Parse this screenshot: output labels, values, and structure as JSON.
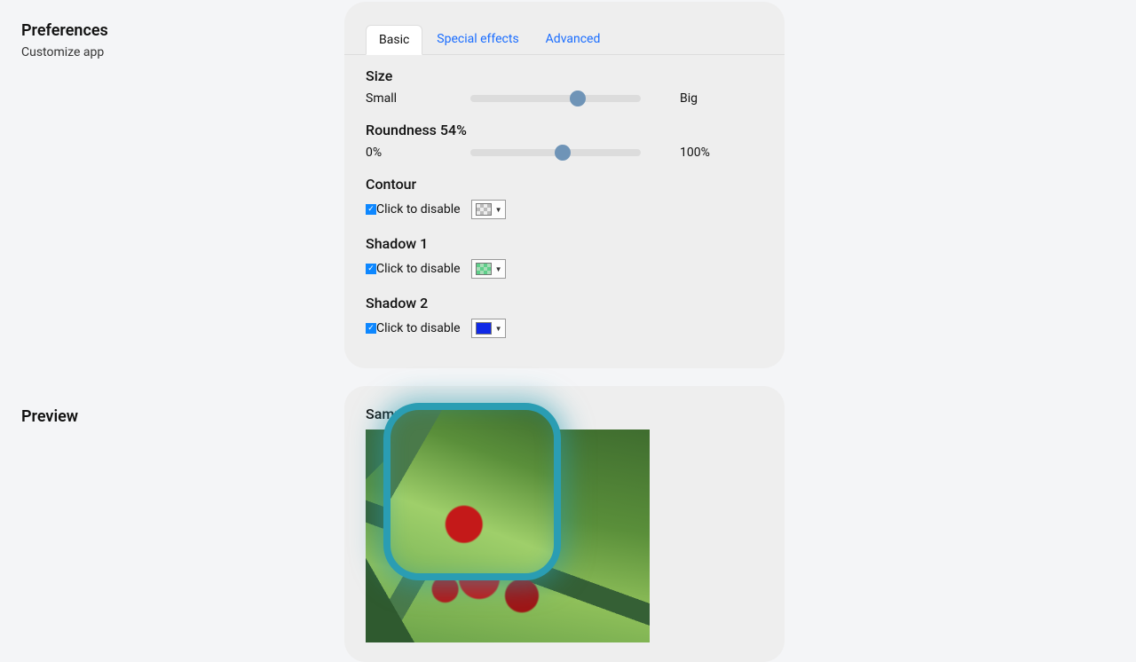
{
  "sections": {
    "prefs": {
      "title": "Preferences",
      "subtitle": "Customize app"
    },
    "preview": {
      "title": "Preview"
    }
  },
  "tabs": {
    "basic": "Basic",
    "special": "Special effects",
    "advanced": "Advanced"
  },
  "settings": {
    "size": {
      "title": "Size",
      "min_label": "Small",
      "max_label": "Big",
      "value_pct": 63
    },
    "roundness": {
      "title": "Roundness 54%",
      "min_label": "0%",
      "max_label": "100%",
      "value_pct": 54
    },
    "contour": {
      "title": "Contour",
      "toggle_label": "Click to disable",
      "checked": true
    },
    "shadow1": {
      "title": "Shadow 1",
      "toggle_label": "Click to disable",
      "checked": true
    },
    "shadow2": {
      "title": "Shadow 2",
      "toggle_label": "Click to disable",
      "checked": true
    }
  },
  "preview_panel": {
    "sample_label": "Sample"
  }
}
